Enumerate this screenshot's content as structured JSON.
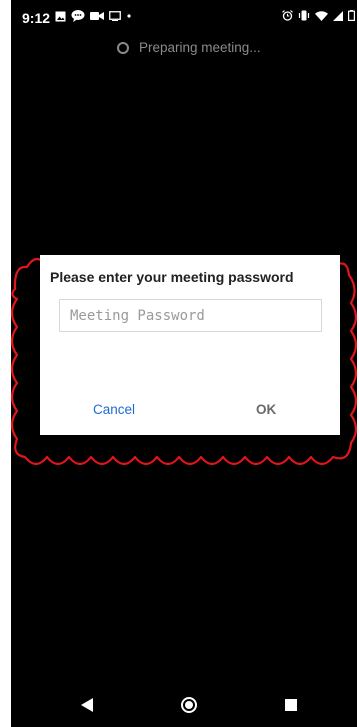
{
  "status_bar": {
    "time": "9:12",
    "left_icons": [
      "image-icon",
      "chat-bubble-icon",
      "video-camera-icon",
      "cast-icon",
      "dot-icon"
    ],
    "right_icons": [
      "alarm-icon",
      "vibrate-icon",
      "wifi-icon",
      "signal-icon",
      "battery-icon"
    ]
  },
  "loading": {
    "text": "Preparing meeting..."
  },
  "dialog": {
    "title": "Please enter your meeting password",
    "password_placeholder": "Meeting Password",
    "cancel_label": "Cancel",
    "ok_label": "OK"
  },
  "annotation": {
    "outline_color": "#e0161b"
  },
  "colors": {
    "background": "#000000",
    "dialog_background": "#ffffff",
    "cancel_text": "#1f6bd0",
    "ok_text": "#6a6a6a"
  },
  "nav_bar": {
    "icons": [
      "back-icon",
      "home-icon",
      "recents-icon"
    ]
  }
}
